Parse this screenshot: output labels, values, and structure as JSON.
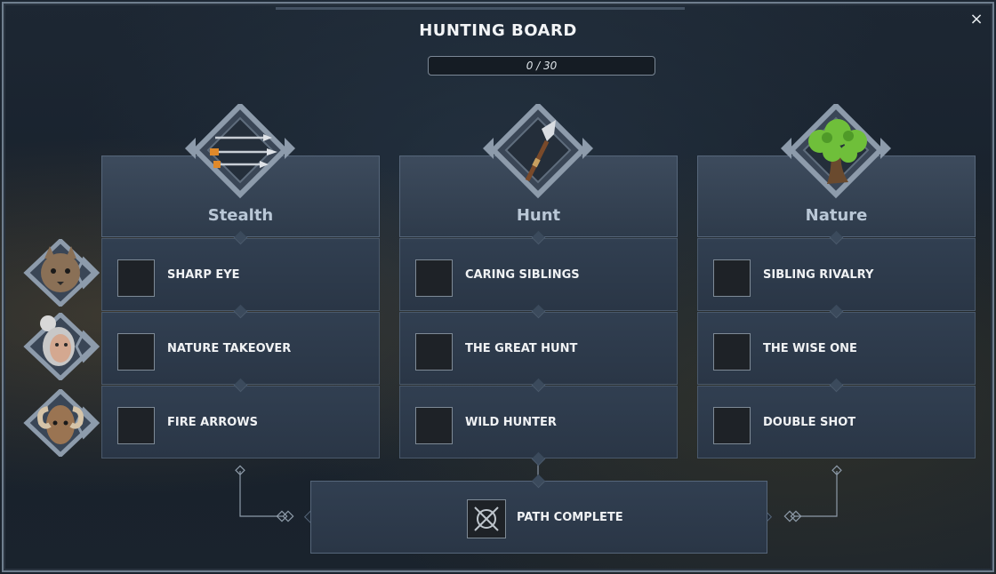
{
  "board": {
    "title": "HUNTING BOARD",
    "progress_text": "0 / 30",
    "progress": {
      "current": 0,
      "max": 30
    },
    "close_label": "×"
  },
  "columns": [
    {
      "name": "Stealth",
      "emblem_icon": "arrows-icon"
    },
    {
      "name": "Hunt",
      "emblem_icon": "spear-icon"
    },
    {
      "name": "Nature",
      "emblem_icon": "tree-icon"
    }
  ],
  "rows": [
    {
      "portrait_icon": "lynx-portrait-icon",
      "cards": [
        {
          "label": "SHARP EYE",
          "icon": "wolf-head-icon"
        },
        {
          "label": "CARING SIBLINGS",
          "icon": "wolf-pair-icon"
        },
        {
          "label": "SIBLING RIVALRY",
          "icon": "snarling-wolf-icon"
        }
      ]
    },
    {
      "portrait_icon": "huntress-portrait-icon",
      "cards": [
        {
          "label": "NATURE TAKEOVER",
          "icon": "leaf-shadow-icon"
        },
        {
          "label": "THE GREAT HUNT",
          "icon": "beast-icon"
        },
        {
          "label": "THE WISE ONE",
          "icon": "rune-icon"
        }
      ]
    },
    {
      "portrait_icon": "ram-portrait-icon",
      "cards": [
        {
          "label": "FIRE ARROWS",
          "icon": "flaming-arrows-icon"
        },
        {
          "label": "WILD HUNTER",
          "icon": "boar-icon"
        },
        {
          "label": "DOUBLE SHOT",
          "icon": "twin-arrows-icon"
        }
      ]
    }
  ],
  "final": {
    "label": "PATH COMPLETE",
    "icon": "crossed-arrows-emblem-icon"
  },
  "colors": {
    "accent": "#b9c7d6",
    "panel": "#2e3b4b",
    "border": "#6f7e8e"
  }
}
